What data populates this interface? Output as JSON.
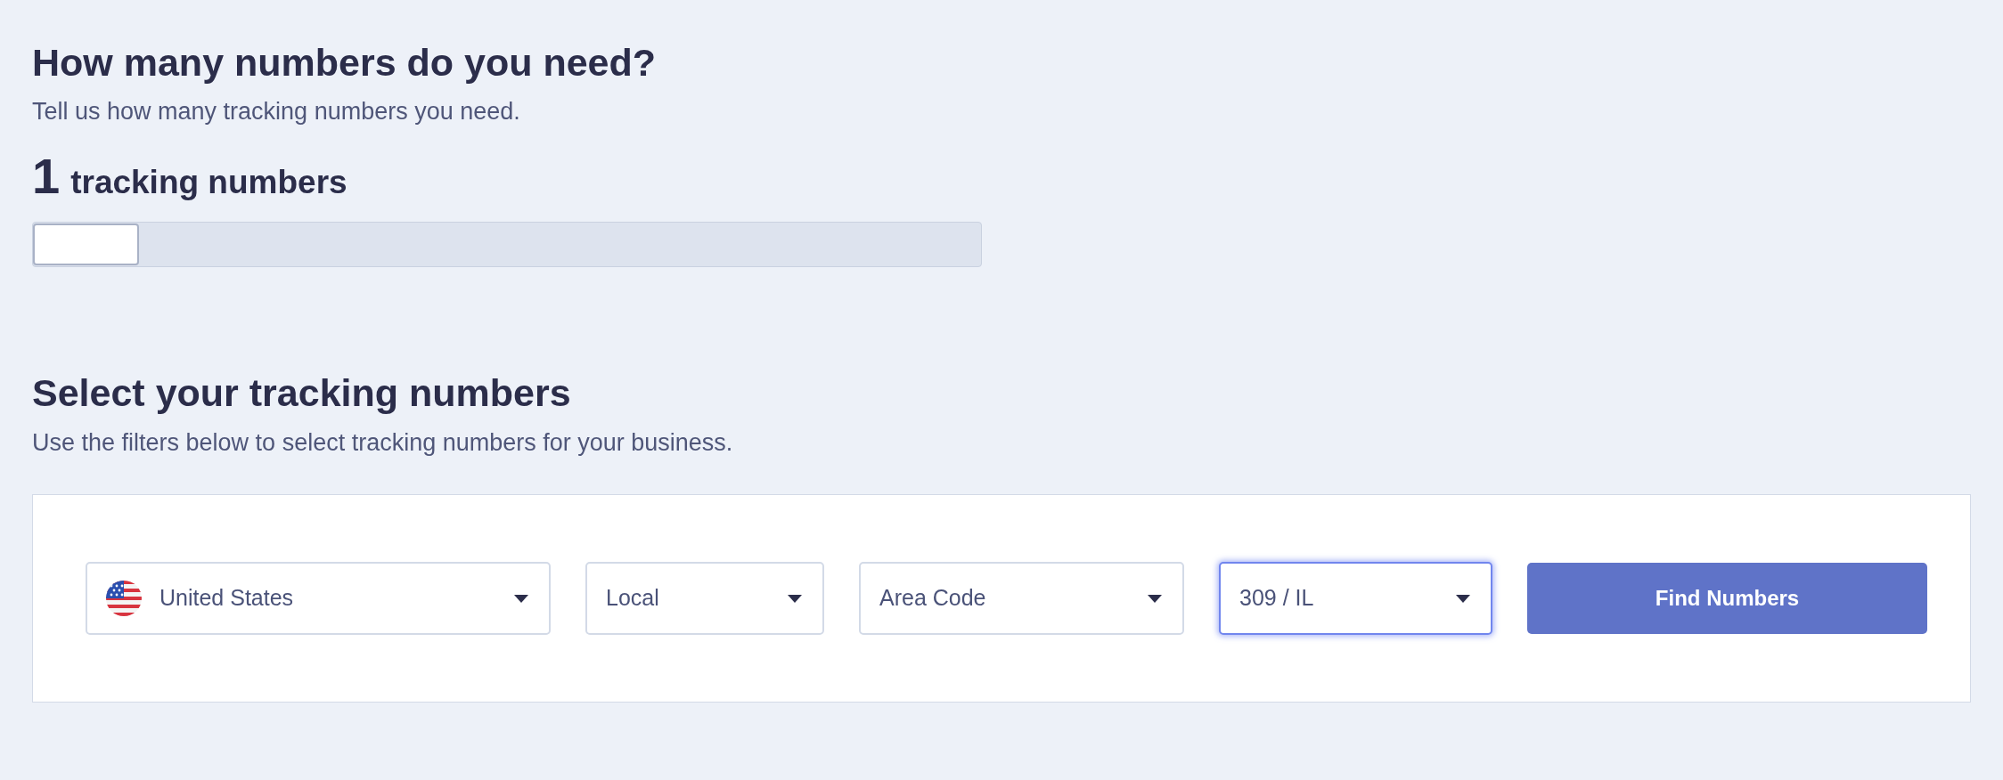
{
  "quantity": {
    "heading": "How many numbers do you need?",
    "subtitle": "Tell us how many tracking numbers you need.",
    "count": "1",
    "count_label": "tracking numbers",
    "slider": {
      "level": 0
    }
  },
  "selection": {
    "heading": "Select your tracking numbers",
    "subtitle": "Use the filters below to select tracking numbers for your business.",
    "filters": [
      {
        "kind": "country",
        "value": "United States",
        "focused": false
      },
      {
        "kind": "select",
        "value": "Local",
        "focused": false
      },
      {
        "kind": "select",
        "value": "Area Code",
        "focused": false
      },
      {
        "kind": "select",
        "value": "309 / IL",
        "focused": true
      }
    ],
    "button": {
      "label": "Find Numbers"
    }
  }
}
